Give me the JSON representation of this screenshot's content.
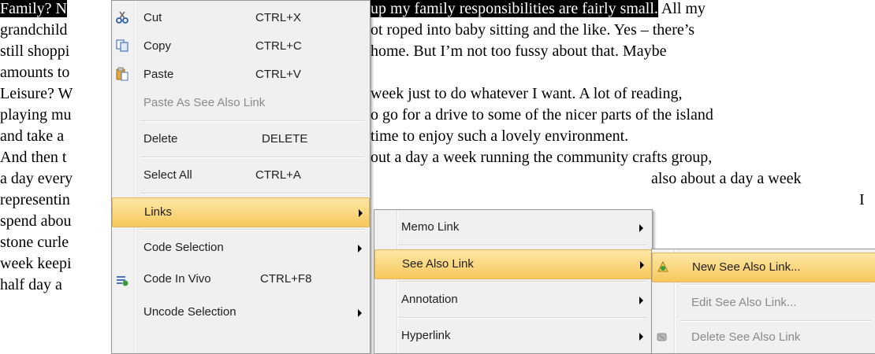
{
  "document": {
    "lines": [
      {
        "selected": "Family? N",
        "rest": ""
      },
      {
        "selected": "",
        "rest": "grandchild"
      },
      {
        "selected": "",
        "rest": "still shoppi"
      },
      {
        "selected": "",
        "rest": "amounts to"
      },
      {
        "selected": "",
        "rest": "Leisure? W"
      },
      {
        "selected": "",
        "rest": "playing mu"
      },
      {
        "selected": "",
        "rest": "and take a"
      },
      {
        "selected": "",
        "rest": "And then t"
      },
      {
        "selected": "",
        "rest": "a day every"
      },
      {
        "selected": "",
        "rest": "representin"
      },
      {
        "selected": "",
        "rest": "spend abou"
      },
      {
        "selected": "",
        "rest": "stone curle"
      },
      {
        "selected": "",
        "rest": "week keepi"
      },
      {
        "selected": "",
        "rest": "half day a"
      }
    ],
    "right_lines": [
      {
        "selected": "up my family responsibilities are fairly small.",
        "rest": " All my"
      },
      {
        "selected": "",
        "rest": "ot roped into baby sitting and the like. Yes – there’s"
      },
      {
        "selected": "",
        "rest": "home. But I’m not too fussy about that. Maybe"
      },
      {
        "selected": "",
        "rest": ""
      },
      {
        "selected": "",
        "rest": "week just to do whatever I want. A lot of reading,"
      },
      {
        "selected": "",
        "rest": "o go for a drive to some of the nicer parts of the island"
      },
      {
        "selected": "",
        "rest": "time to enjoy such a lovely environment."
      },
      {
        "selected": "",
        "rest": "out a day a week running the community crafts group,"
      }
    ],
    "far_right_lines": [
      {
        "rest": "also about a day a week"
      },
      {
        "rest": "I"
      }
    ]
  },
  "context_menu": {
    "items": [
      {
        "label": "Cut",
        "shortcut": "CTRL+X",
        "icon": "scissors-icon"
      },
      {
        "label": "Copy",
        "shortcut": "CTRL+C",
        "icon": "copy-icon"
      },
      {
        "label": "Paste",
        "shortcut": "CTRL+V",
        "icon": "paste-icon"
      },
      {
        "label": "Paste As See Also Link",
        "shortcut": "",
        "disabled": true
      },
      {
        "label": "Delete",
        "shortcut": "DELETE"
      },
      {
        "label": "Select All",
        "shortcut": "CTRL+A"
      },
      {
        "label": "Links",
        "submenu": true,
        "highlighted": true
      },
      {
        "label": "Code Selection",
        "submenu": true
      },
      {
        "label": "Code In Vivo",
        "shortcut": "CTRL+F8",
        "icon": "code-in-vivo-icon"
      },
      {
        "label": "Uncode Selection",
        "submenu": true
      }
    ]
  },
  "links_submenu": {
    "items": [
      {
        "label": "Memo Link",
        "submenu": true
      },
      {
        "label": "See Also Link",
        "submenu": true,
        "highlighted": true
      },
      {
        "label": "Annotation",
        "submenu": true
      },
      {
        "label": "Hyperlink",
        "submenu": true
      }
    ]
  },
  "see_also_submenu": {
    "items": [
      {
        "label": "New See Also Link...",
        "highlighted": true,
        "icon": "new-link-icon"
      },
      {
        "label": "Edit See Also Link...",
        "disabled": true
      },
      {
        "label": "Delete See Also Link",
        "disabled": true,
        "icon": "delete-link-icon"
      }
    ]
  },
  "colors": {
    "highlight": "#f7c85c",
    "selection": "#000000",
    "menu_bg": "#f0f0f0"
  }
}
